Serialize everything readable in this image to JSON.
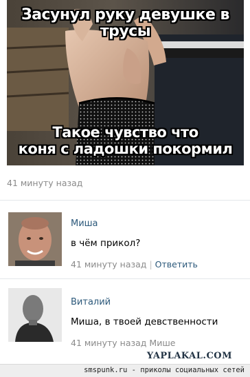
{
  "post": {
    "image_top_text": "Засунул руку девушке в трусы",
    "image_bottom_text_1": "Такое чувство что",
    "image_bottom_text_2": "коня с ладошки покормил",
    "time": "41 минуту назад"
  },
  "comments": [
    {
      "author": "Миша",
      "text": "в чём прикол?",
      "time": "41 минуту назад",
      "reply_label": "Ответить"
    },
    {
      "author": "Виталий",
      "text": "Миша, в твоей девственности",
      "time": "41 минуту назад",
      "reply_to": "Мише"
    }
  ],
  "watermark": "YAPLAKAL.COM",
  "footer": "smspunk.ru - приколы социальных сетей",
  "colors": {
    "link": "#2b587a",
    "meta": "#8a8a8a",
    "divider": "#e4e7ea"
  }
}
